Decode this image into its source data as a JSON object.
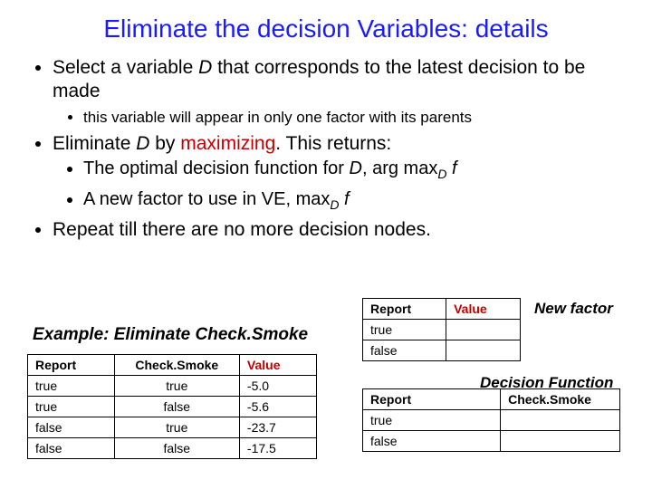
{
  "title": "Eliminate the decision Variables: details",
  "bullets": {
    "b1_a": "Select a variable ",
    "b1_D": "D",
    "b1_b": " that corresponds to the latest decision to be made",
    "b1_sub": "this variable will appear in only one factor with its parents",
    "b2_a": "Eliminate ",
    "b2_D": "D",
    "b2_b": " by ",
    "b2_max": "maximizing",
    "b2_c": ". This returns:",
    "b2_sub1_a": "The optimal decision function for ",
    "b2_sub1_D": "D",
    "b2_sub1_b": ", arg max",
    "b2_sub1_sub": "D",
    "b2_sub1_f": " f",
    "b2_sub2_a": "A new factor to use in VE, max",
    "b2_sub2_sub": "D",
    "b2_sub2_f": " f",
    "b3": "Repeat till there are no more decision nodes."
  },
  "example_label": "Example: Eliminate Check.Smoke",
  "left_table": {
    "h1": "Report",
    "h2": "Check.Smoke",
    "h3": "Value",
    "rows": [
      {
        "r": "true",
        "c": "true",
        "v": "-5.0"
      },
      {
        "r": "true",
        "c": "false",
        "v": "-5.6"
      },
      {
        "r": "false",
        "c": "true",
        "v": "-23.7"
      },
      {
        "r": "false",
        "c": "false",
        "v": "-17.5"
      }
    ]
  },
  "new_factor_label": "New factor",
  "right_table1": {
    "h1": "Report",
    "h2": "Value",
    "rows": [
      {
        "r": "true",
        "v": ""
      },
      {
        "r": "false",
        "v": ""
      }
    ]
  },
  "decision_fn_label": "Decision Function",
  "right_table2": {
    "h1": "Report",
    "h2": "Check.Smoke",
    "rows": [
      {
        "r": "true",
        "c": ""
      },
      {
        "r": "false",
        "c": ""
      }
    ]
  }
}
